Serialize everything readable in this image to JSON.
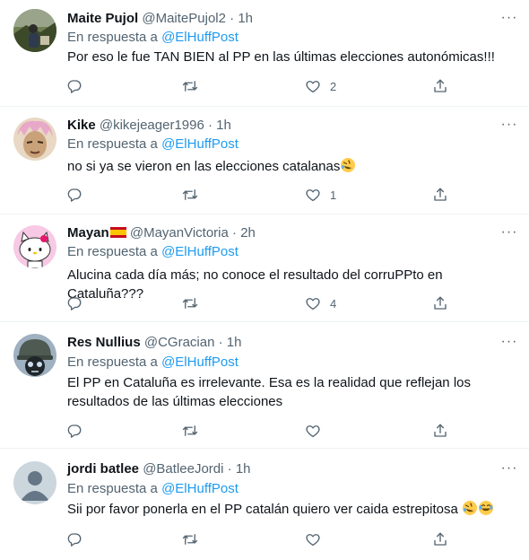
{
  "tweets": [
    {
      "name": "Maite Pujol",
      "handle": "@MaitePujol2",
      "time": "1h",
      "reply_prefix": "En respuesta a",
      "reply_to": "@ElHuffPost",
      "text": "Por eso le fue TAN BIEN al PP en las últimas elecciones autonómicas!!!",
      "likes": "2",
      "avatar": "photo-outdoor"
    },
    {
      "name": "Kike",
      "handle": "@kikejeager1996",
      "time": "1h",
      "reply_prefix": "En respuesta a",
      "reply_to": "@ElHuffPost",
      "text": "no si ya se vieron en las elecciones catalanas",
      "emoji": "rolling-on-floor-laughing",
      "likes": "1",
      "avatar": "anime-character"
    },
    {
      "name": "Mayan",
      "name_flag": "spain-flag",
      "handle": "@MayanVictoria",
      "time": "2h",
      "reply_prefix": "En respuesta a",
      "reply_to": "@ElHuffPost",
      "text": "Alucina cada día más; no conoce el resultado del corruPPto en Cataluña???",
      "likes": "4",
      "avatar": "hello-kitty"
    },
    {
      "name": "Res Nullius",
      "handle": "@CGracian",
      "time": "1h",
      "reply_prefix": "En respuesta a",
      "reply_to": "@ElHuffPost",
      "text_line1": "El PP en Cataluña es irrelevante. Esa es la realidad que reflejan los",
      "text_line2": "resultados de las últimas elecciones",
      "likes": "",
      "avatar": "helmet-skull"
    },
    {
      "name": "jordi batlee",
      "handle": "@BatleeJordi",
      "time": "1h",
      "reply_prefix": "En respuesta a",
      "reply_to": "@ElHuffPost",
      "text": "Sii por favor ponerla en el PP catalán quiero ver caida estrepitosa",
      "emoji": "rolling-on-floor-laughing, face-with-tears-of-joy",
      "likes": "",
      "avatar": "default-avatar"
    }
  ],
  "ui": {
    "dot": "·",
    "more": "···"
  },
  "colors": {
    "accent": "#1d9bf0",
    "secondary_text": "#536471",
    "divider": "#eff3f4"
  }
}
